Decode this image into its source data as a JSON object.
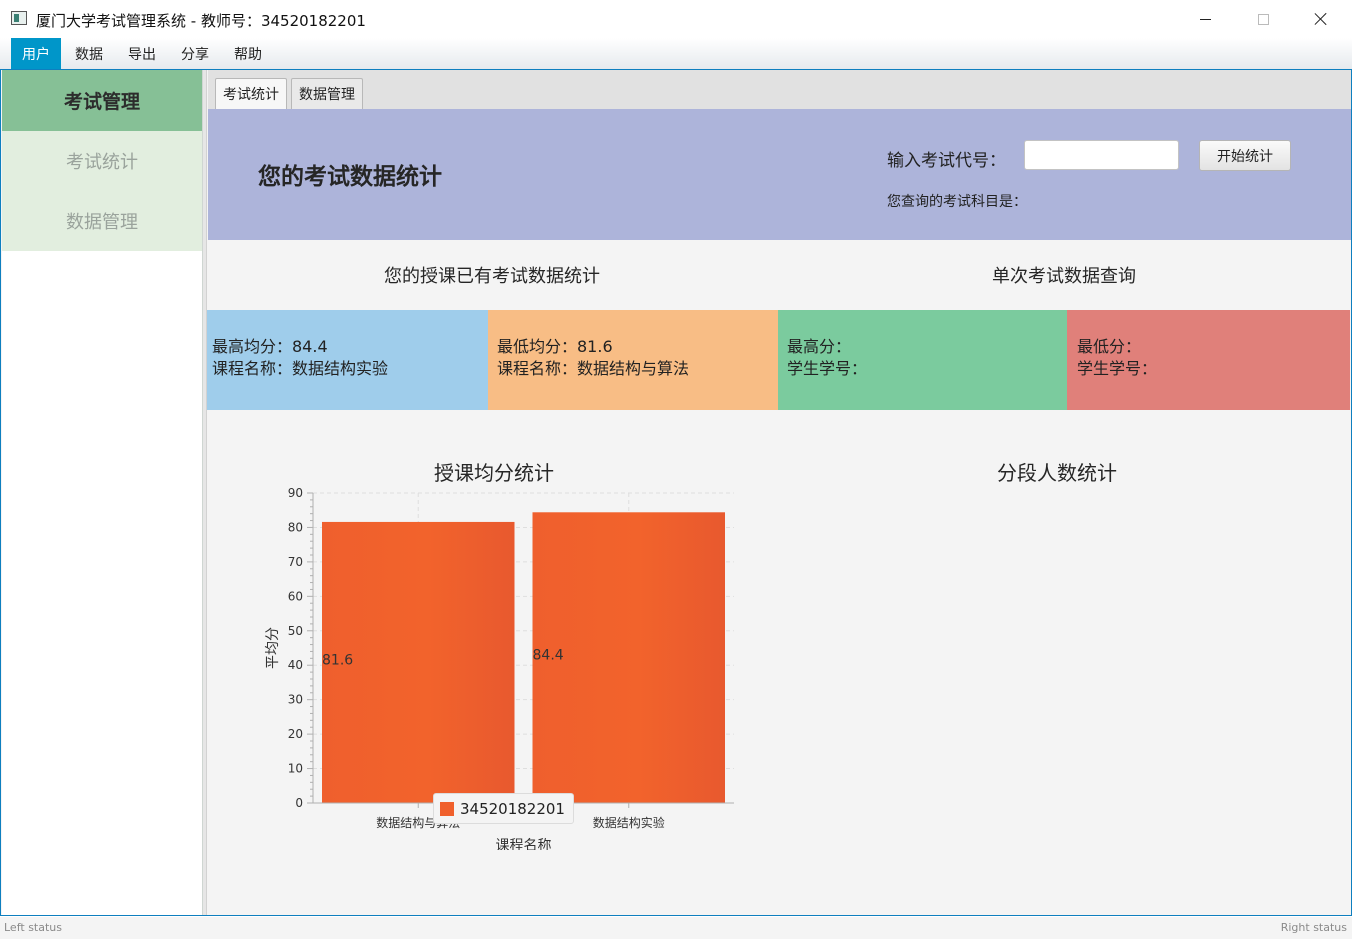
{
  "window": {
    "title": "厦门大学考试管理系统 - 教师号：34520182201"
  },
  "menu": {
    "items": [
      "用户",
      "数据",
      "导出",
      "分享",
      "帮助"
    ]
  },
  "sidebar": {
    "header": "考试管理",
    "items": [
      "考试统计",
      "数据管理"
    ]
  },
  "tabs": [
    "考试统计",
    "数据管理"
  ],
  "header": {
    "title": "您的考试数据统计",
    "code_label": "输入考试代号：",
    "code_value": "",
    "start_button": "开始统计",
    "subject_label": "您查询的考试科目是："
  },
  "sections": {
    "left_title": "您的授课已有考试数据统计",
    "right_title": "单次考试数据查询"
  },
  "cards": {
    "highest_avg": {
      "line1": "最高均分：84.4",
      "line2": "课程名称：数据结构实验"
    },
    "lowest_avg": {
      "line1": "最低均分：81.6",
      "line2": "课程名称：数据结构与算法"
    },
    "highest": {
      "line1": "最高分：",
      "line2": "学生学号："
    },
    "lowest": {
      "line1": "最低分：",
      "line2": "学生学号："
    }
  },
  "chart_titles": {
    "right": "分段人数统计"
  },
  "chart_data": {
    "type": "bar",
    "title": "授课均分统计",
    "xlabel": "课程名称",
    "ylabel": "平均分",
    "categories": [
      "数据结构与算法",
      "数据结构实验"
    ],
    "series": [
      {
        "name": "34520182201",
        "values": [
          81.6,
          84.4
        ]
      }
    ],
    "ylim": [
      0,
      90
    ],
    "yticks": [
      0,
      10,
      20,
      30,
      40,
      50,
      60,
      70,
      80,
      90
    ],
    "grid": true,
    "legend_position": "bottom",
    "bar_color": "#f0602c"
  },
  "status": {
    "left": "Left status",
    "right": "Right status"
  }
}
